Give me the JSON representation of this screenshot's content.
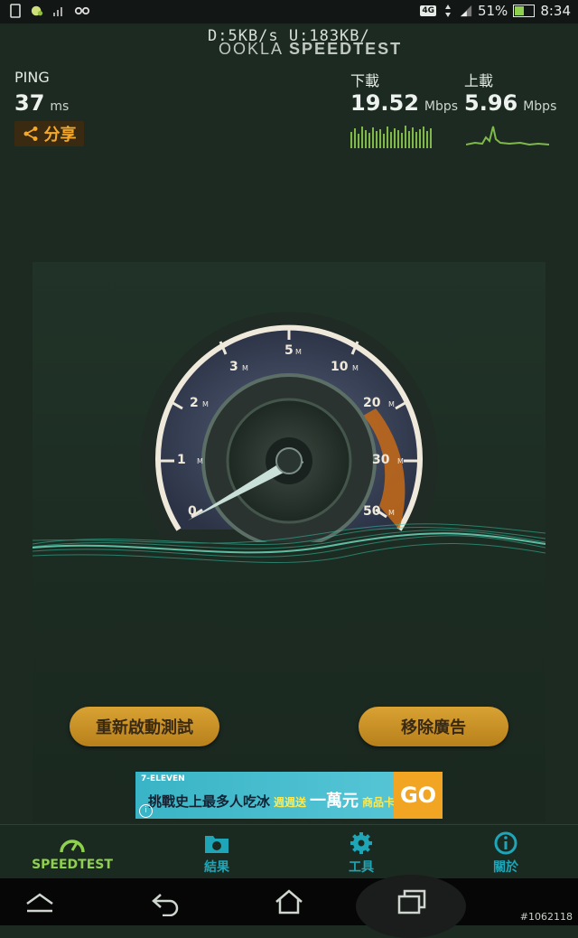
{
  "statusbar": {
    "network": "4G",
    "battery": "51%",
    "time": "8:34"
  },
  "header": {
    "readout": "D:5KB/s  U:183KB/",
    "brand": "OOKLA",
    "brand2": "SPEEDTEST"
  },
  "ping": {
    "label": "PING",
    "value": "37",
    "unit": "ms"
  },
  "share_label": "分享",
  "download": {
    "label": "下載",
    "value": "19.52",
    "unit": "Mbps"
  },
  "upload": {
    "label": "上載",
    "value": "5.96",
    "unit": "Mbps"
  },
  "gauge": {
    "ticks": [
      "0",
      "1",
      "2",
      "3",
      "5",
      "10",
      "20",
      "30",
      "50"
    ],
    "tick_unit": "M",
    "needle_value": "0",
    "accent_color": "#c76a18"
  },
  "buttons": {
    "restart": "重新啟動測試",
    "remove_ads": "移除廣告"
  },
  "ad": {
    "brand": "7-ELEVEN",
    "line1": "挑戰史上最多人吃冰",
    "line2": "週週送",
    "line3": "一萬元",
    "line4": "商品卡",
    "cta": "GO",
    "info": "i"
  },
  "tabs": [
    {
      "label": "SPEEDTEST",
      "icon": "speedometer-icon"
    },
    {
      "label": "結果",
      "icon": "folder-results-icon"
    },
    {
      "label": "工具",
      "icon": "gear-icon"
    },
    {
      "label": "關於",
      "icon": "info-icon"
    }
  ],
  "watermark": "#1062118"
}
